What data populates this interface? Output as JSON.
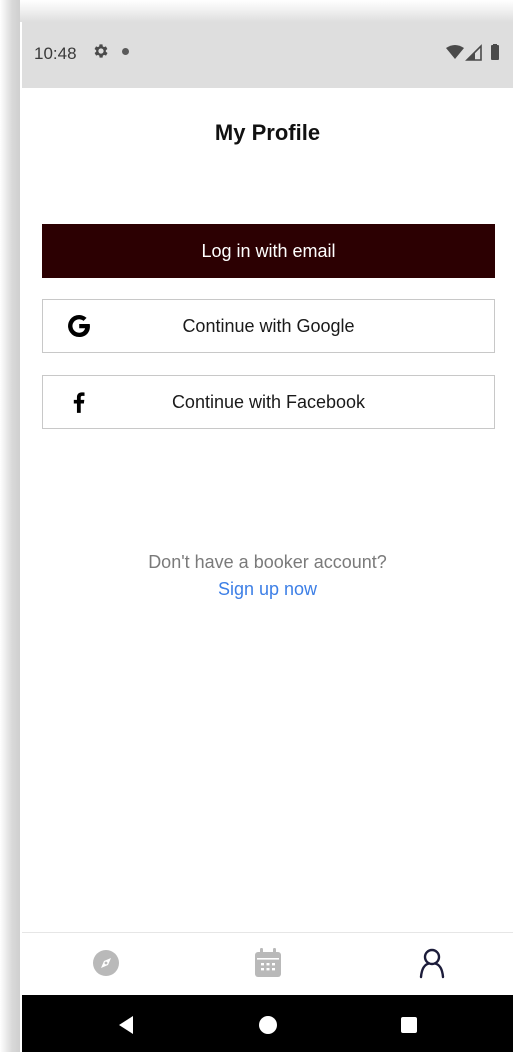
{
  "status_bar": {
    "time": "10:48",
    "icons": [
      "gear-icon",
      "notification-dot-icon",
      "wifi-icon",
      "signal-icon",
      "battery-icon"
    ]
  },
  "page": {
    "title": "My Profile"
  },
  "auth": {
    "email_button_label": "Log in with email",
    "google_button_label": "Continue with Google",
    "facebook_button_label": "Continue with Facebook",
    "signup_prompt": "Don't have a booker account?",
    "signup_link": "Sign up now"
  },
  "tab_bar": {
    "tabs": [
      {
        "icon": "compass-icon",
        "active": false
      },
      {
        "icon": "calendar-icon",
        "active": false
      },
      {
        "icon": "profile-icon",
        "active": true
      }
    ]
  },
  "system_nav": {
    "buttons": [
      "back-icon",
      "home-icon",
      "recents-icon"
    ]
  },
  "colors": {
    "email_button_bg": "#2c0002",
    "link": "#3d7fe6",
    "active_tab": "#1c1c3a",
    "inactive_tab": "#b9b9b9"
  }
}
